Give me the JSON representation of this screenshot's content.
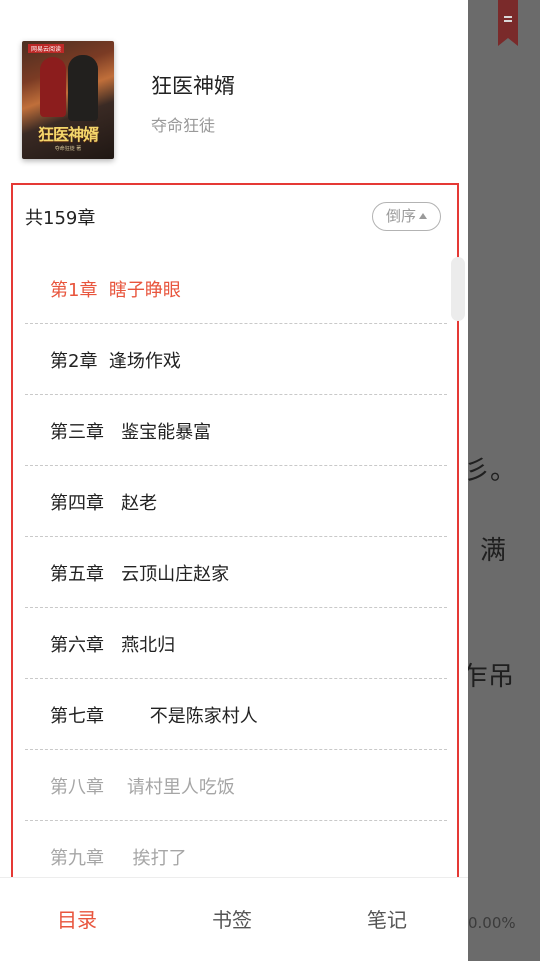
{
  "background_reader": {
    "fragments": [
      "彡。",
      "满",
      "乍吊"
    ],
    "progress": "0.00%"
  },
  "book": {
    "title": "狂医神婿",
    "author": "夺命狂徒",
    "cover": {
      "ribbon": "网易云阅读",
      "title_art": "狂医神婿",
      "subtitle": "夺命狂徒 著"
    }
  },
  "toc": {
    "count_label": "共159章",
    "sort_label": "倒序",
    "chapters": [
      {
        "label": "第1章  瞎子睁眼",
        "state": "current"
      },
      {
        "label": "第2章  逢场作戏",
        "state": "normal"
      },
      {
        "label": "第三章   鉴宝能暴富",
        "state": "normal"
      },
      {
        "label": "第四章   赵老",
        "state": "normal"
      },
      {
        "label": "第五章   云顶山庄赵家",
        "state": "normal"
      },
      {
        "label": "第六章   燕北归",
        "state": "normal"
      },
      {
        "label": "第七章        不是陈家村人",
        "state": "normal"
      },
      {
        "label": "第八章    请村里人吃饭",
        "state": "locked"
      },
      {
        "label": "第九章     挨打了",
        "state": "locked"
      }
    ]
  },
  "tabs": [
    "目录",
    "书签",
    "笔记"
  ],
  "colors": {
    "accent": "#e8553d",
    "highlight_border": "#e53935",
    "overlay": "#6b6b6b"
  }
}
